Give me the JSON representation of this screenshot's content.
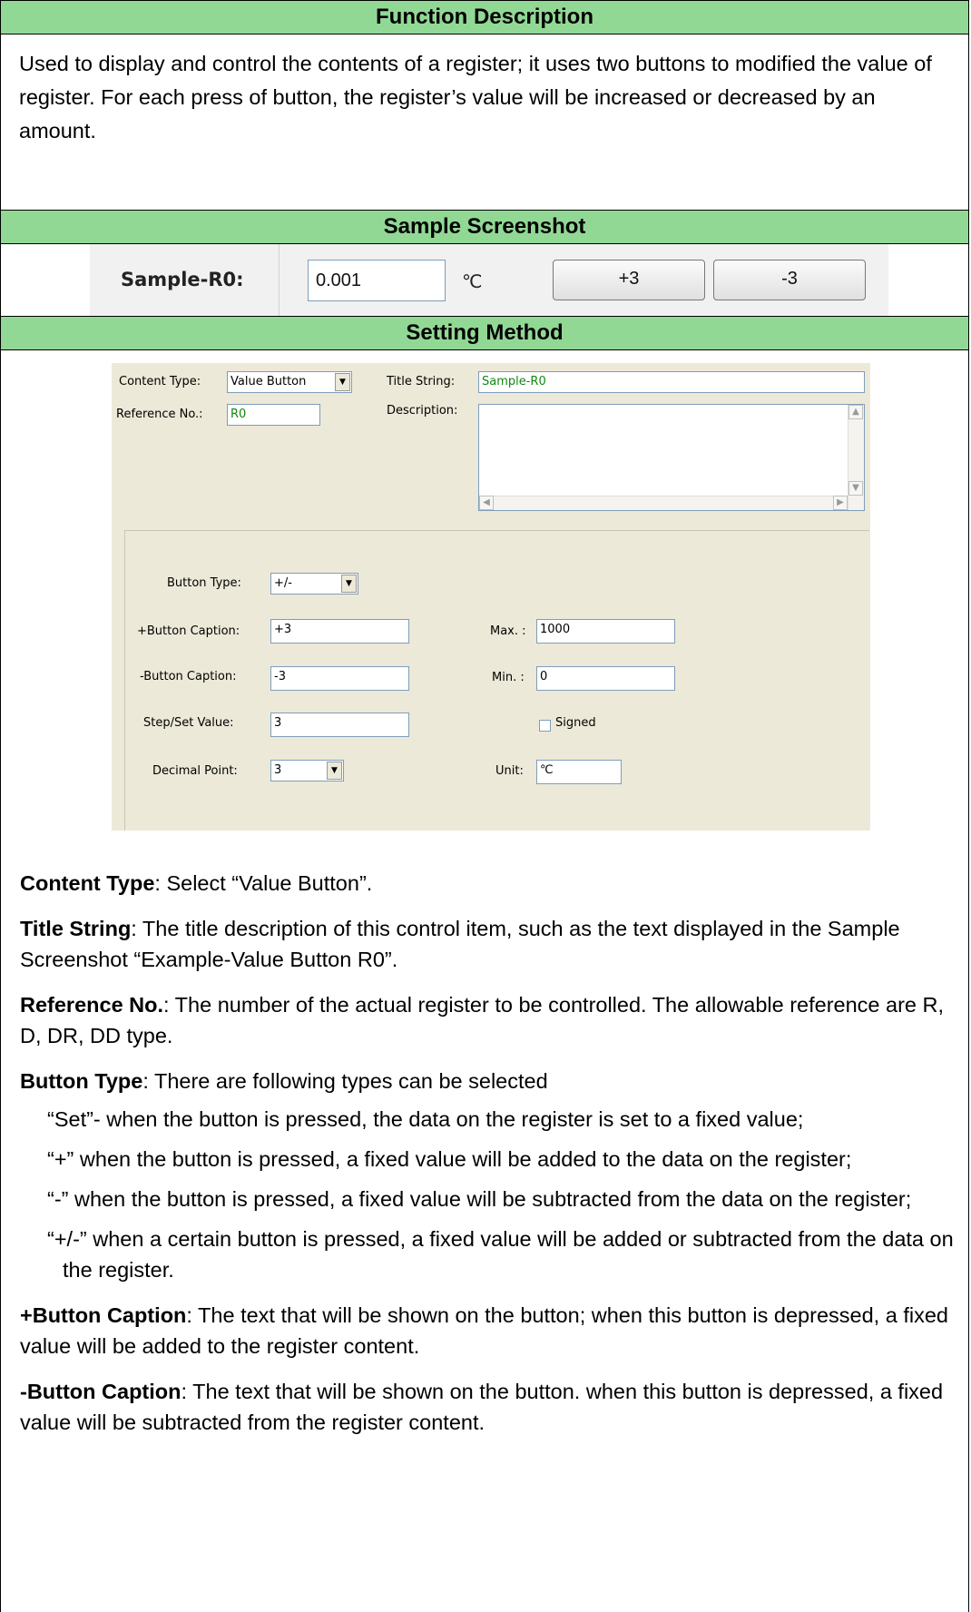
{
  "headers": {
    "function_description": "Function Description",
    "sample_screenshot": "Sample Screenshot",
    "setting_method": "Setting Method"
  },
  "description": "Used to display and control the contents of a register; it uses two buttons to modified the value of register. For each press of button, the register’s value will be increased or decreased by an amount.",
  "sample": {
    "label": "Sample-R0:",
    "value": "0.001",
    "unit": "℃",
    "plus_button": "+3",
    "minus_button": "-3"
  },
  "form": {
    "content_type_label": "Content Type:",
    "content_type_value": "Value Button",
    "title_string_label": "Title String:",
    "title_string_value": "Sample-R0",
    "reference_no_label": "Reference No.:",
    "reference_no_value": "R0",
    "description_label": "Description:",
    "button_type_label": "Button Type:",
    "button_type_value": "+/-",
    "plus_caption_label": "+Button Caption:",
    "plus_caption_value": "+3",
    "minus_caption_label": "-Button Caption:",
    "minus_caption_value": "-3",
    "step_label": "Step/Set Value:",
    "step_value": "3",
    "decimal_label": "Decimal Point:",
    "decimal_value": "3",
    "max_label": "Max. :",
    "max_value": "1000",
    "min_label": "Min. :",
    "min_value": "0",
    "signed_label": "Signed",
    "unit_label": "Unit:",
    "unit_value": "℃"
  },
  "body": {
    "content_type_term": "Content Type",
    "content_type_text": ": Select “Value Button”.",
    "title_string_term": "Title String",
    "title_string_text": ": The title description of this control item, such as the text displayed in the Sample Screenshot “Example-Value Button R0”.",
    "reference_no_term": "Reference No.",
    "reference_no_text": ": The number of the actual register to be controlled. The allowable reference are R, D, DR, DD type.",
    "button_type_term": "Button Type",
    "button_type_text": ": There are following types can be selected",
    "type_set": "“Set”- when the button is pressed, the data on the register is set to a fixed value;",
    "type_plus": "“+” when the button is pressed, a fixed value will be added to the data on the register;",
    "type_minus": "“-” when the button is pressed, a fixed value will be subtracted from the data on the register;",
    "type_plusminus": "“+/-” when a certain button is pressed, a fixed value will be added or subtracted from the data on the register.",
    "plus_caption_term": "+Button Caption",
    "plus_caption_text": ": The text that will be shown on the button; when this button is depressed, a fixed value will be added to the register content.",
    "minus_caption_term": "-Button Caption",
    "minus_caption_text": ": The text that will be shown on the button. when this button is depressed, a fixed value will be subtracted from the register content."
  },
  "colors": {
    "header_bg": "#92d895",
    "form_bg": "#ece9d8",
    "field_value_text": "#118811"
  }
}
